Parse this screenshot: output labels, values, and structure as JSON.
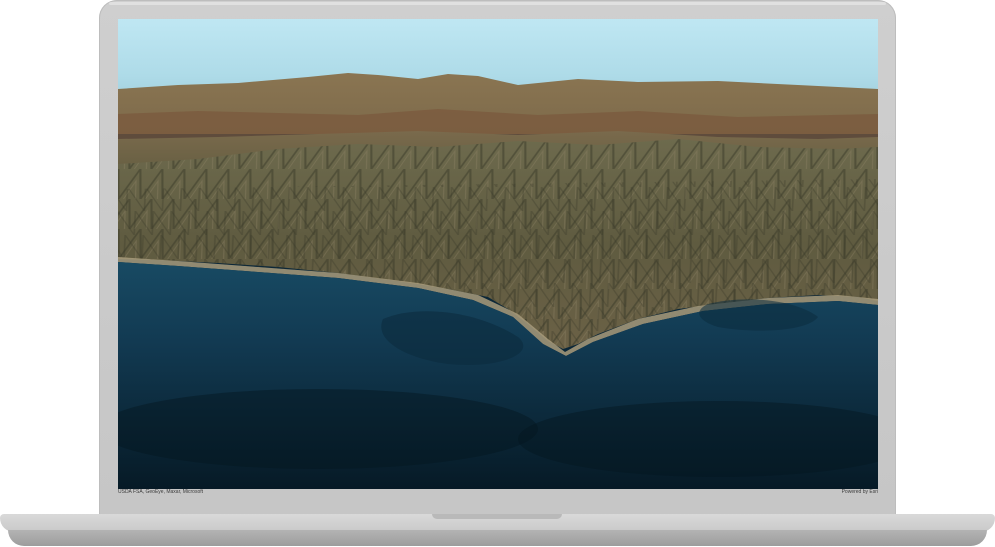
{
  "screen": {
    "content": "3D satellite terrain view of mountains and coastline",
    "attribution_left": "USDA FSA, GeoEye, Maxar, Microsoft",
    "attribution_right": "Powered by Esri"
  },
  "colors": {
    "device_frame": "#c6c6c6",
    "sky": "#bfe7f3",
    "ocean": "#0c2738",
    "terrain": "#6b6448"
  }
}
